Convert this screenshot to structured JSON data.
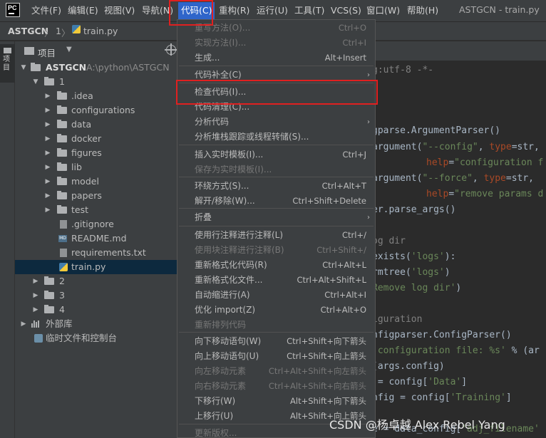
{
  "menubar": {
    "items": [
      "文件(F)",
      "编辑(E)",
      "视图(V)",
      "导航(N)",
      "代码(C)",
      "重构(R)",
      "运行(U)",
      "工具(T)",
      "VCS(S)",
      "窗口(W)",
      "帮助(H)"
    ],
    "window_title": "ASTGCN - train.py"
  },
  "breadcrumb": {
    "project": "ASTGCN",
    "sep1": "〉",
    "num": "1",
    "sep2": "〉",
    "file": "train.py"
  },
  "tool_strip": {
    "project_tab": "项目"
  },
  "project_panel": {
    "title": "项目",
    "root_name": "ASTGCN",
    "root_path": "A:\\python\\ASTGCN",
    "tree": [
      "1",
      ".idea",
      "configurations",
      "data",
      "docker",
      "figures",
      "lib",
      "model",
      "papers",
      "test",
      ".gitignore",
      "README.md",
      "requirements.txt",
      "train.py",
      "2",
      "3",
      "4",
      "外部库",
      "临时文件和控制台"
    ],
    "md_badge": "MD"
  },
  "code_menu": {
    "items": [
      {
        "label": "重写方法(O)...",
        "shortcut": "Ctrl+O",
        "disabled": true
      },
      {
        "label": "实现方法(I)...",
        "shortcut": "Ctrl+I",
        "disabled": true
      },
      {
        "label": "生成...",
        "shortcut": "Alt+Insert",
        "disabled": false
      },
      {
        "label": "代码补全(C)",
        "shortcut": "",
        "disabled": false,
        "submenu": true
      },
      {
        "label": "检查代码(I)...",
        "shortcut": "",
        "disabled": false
      },
      {
        "label": "代码清理(C)...",
        "shortcut": "",
        "disabled": false
      },
      {
        "label": "分析代码",
        "shortcut": "",
        "disabled": false,
        "submenu": true
      },
      {
        "label": "分析堆栈跟踪或线程转储(S)...",
        "shortcut": "",
        "disabled": false
      },
      {
        "label": "插入实时模板(I)...",
        "shortcut": "Ctrl+J",
        "disabled": false
      },
      {
        "label": "保存为实时模板(I)...",
        "shortcut": "",
        "disabled": true
      },
      {
        "label": "环绕方式(S)...",
        "shortcut": "Ctrl+Alt+T",
        "disabled": false
      },
      {
        "label": "解开/移除(W)...",
        "shortcut": "Ctrl+Shift+Delete",
        "disabled": false
      },
      {
        "label": "折叠",
        "shortcut": "",
        "disabled": false,
        "submenu": true
      },
      {
        "label": "使用行注释进行注释(L)",
        "shortcut": "Ctrl+/",
        "disabled": false
      },
      {
        "label": "使用块注释进行注释(B)",
        "shortcut": "Ctrl+Shift+/",
        "disabled": true
      },
      {
        "label": "重新格式化代码(R)",
        "shortcut": "Ctrl+Alt+L",
        "disabled": false
      },
      {
        "label": "重新格式化文件...",
        "shortcut": "Ctrl+Alt+Shift+L",
        "disabled": false
      },
      {
        "label": "自动缩进行(A)",
        "shortcut": "Ctrl+Alt+I",
        "disabled": false
      },
      {
        "label": "优化 import(Z)",
        "shortcut": "Ctrl+Alt+O",
        "disabled": false
      },
      {
        "label": "重新排列代码",
        "shortcut": "",
        "disabled": true
      },
      {
        "label": "向下移动语句(W)",
        "shortcut": "Ctrl+Shift+向下箭头",
        "disabled": false
      },
      {
        "label": "向上移动语句(U)",
        "shortcut": "Ctrl+Shift+向上箭头",
        "disabled": false
      },
      {
        "label": "向左移动元素",
        "shortcut": "Ctrl+Alt+Shift+向左箭头",
        "disabled": true
      },
      {
        "label": "向右移动元素",
        "shortcut": "Ctrl+Alt+Shift+向右箭头",
        "disabled": true
      },
      {
        "label": "下移行(W)",
        "shortcut": "Alt+Shift+向下箭头",
        "disabled": false
      },
      {
        "label": "上移行(U)",
        "shortcut": "Alt+Shift+向上箭头",
        "disabled": false
      },
      {
        "label": "更新版权...",
        "shortcut": "",
        "disabled": true
      }
    ],
    "submenu_arrow": "›"
  },
  "editor": {
    "lines": [
      [
        "g:utf-8 -*-"
      ],
      [
        ""
      ],
      [
        ""
      ],
      [
        "gparse.ArgumentParser()"
      ],
      [
        "argument(",
        "\"--config\"",
        ", ",
        "type",
        "=str,"
      ],
      [
        "help",
        "=",
        "\"configuration f"
      ],
      [
        "argument(",
        "\"--force\"",
        ", ",
        "type",
        "=str,"
      ],
      [
        "help",
        "=",
        "\"remove params d"
      ],
      [
        "er.parse_args()"
      ],
      [
        ""
      ],
      [
        "og dir"
      ],
      [
        "exists(",
        "'logs'",
        "):"
      ],
      [
        "rmtree(",
        "'logs'",
        ")"
      ],
      [
        "Remove log dir'",
        ")"
      ],
      [
        ""
      ],
      [
        "iguration"
      ],
      [
        "nfigparser.ConfigParser()"
      ],
      [
        " configuration file: %s'",
        " % (ar"
      ],
      [
        "(args.config)"
      ],
      [
        " = config[",
        "'Data'",
        "]"
      ],
      [
        "nfig = config[",
        "'Training'",
        "]"
      ],
      [
        ""
      ],
      [
        "e = data_config[",
        "'adj_filename'"
      ]
    ]
  },
  "watermark": "CSDN @杨卓越 Alex Rebel Yang",
  "colors": {
    "accent_selection": "#2f65ca",
    "highlight_box": "#e02020",
    "menu_bg": "#3c3f41",
    "editor_bg": "#2b2b2b"
  }
}
